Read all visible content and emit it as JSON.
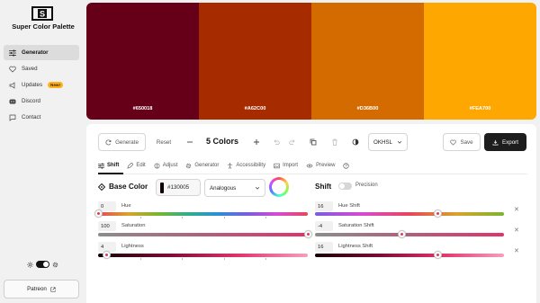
{
  "app": {
    "title": "Super Color Palette"
  },
  "sidebar": {
    "items": [
      {
        "label": "Generator",
        "icon": "sliders-icon",
        "active": true
      },
      {
        "label": "Saved",
        "icon": "heart-icon"
      },
      {
        "label": "Updates",
        "icon": "megaphone-icon",
        "badge": "New!"
      },
      {
        "label": "Discord",
        "icon": "discord-icon"
      },
      {
        "label": "Contact",
        "icon": "message-icon"
      }
    ],
    "patreon": "Patreon"
  },
  "palette": [
    {
      "hex": "#650018",
      "color": "#650018"
    },
    {
      "hex": "#A62C00",
      "color": "#A62C00"
    },
    {
      "hex": "#D36B00",
      "color": "#D36B00"
    },
    {
      "hex": "#FEA700",
      "color": "#FEA700"
    }
  ],
  "toolbar": {
    "generate": "Generate",
    "reset": "Reset",
    "count": "5 Colors",
    "mode": "OKHSL",
    "save": "Save",
    "export": "Export"
  },
  "tabs": [
    {
      "label": "Shift",
      "icon": "sliders-icon",
      "active": true
    },
    {
      "label": "Edit",
      "icon": "pencil-icon"
    },
    {
      "label": "Adjust",
      "icon": "adjust-icon"
    },
    {
      "label": "Generator",
      "icon": "gear-icon"
    },
    {
      "label": "Accessibility",
      "icon": "accessibility-icon"
    },
    {
      "label": "Import",
      "icon": "image-icon"
    },
    {
      "label": "Preview",
      "icon": "eye-icon"
    },
    {
      "label": "",
      "icon": "help-icon"
    }
  ],
  "base": {
    "label": "Base Color",
    "hex": "#130005",
    "harmony": "Analogous"
  },
  "shift": {
    "label": "Shift",
    "precision": "Precision",
    "enabled": false
  },
  "left_sliders": [
    {
      "label": "Hue",
      "value": "0",
      "level": 0.0
    },
    {
      "label": "Saturation",
      "value": "100",
      "level": 1.0
    },
    {
      "label": "Lightness",
      "value": "4",
      "level": 0.04
    }
  ],
  "right_sliders": [
    {
      "label": "Hue Shift",
      "value": "16",
      "level": 0.65
    },
    {
      "label": "Saturation Shift",
      "value": "-4",
      "level": 0.46
    },
    {
      "label": "Lightness Shift",
      "value": "16",
      "level": 0.65
    }
  ]
}
